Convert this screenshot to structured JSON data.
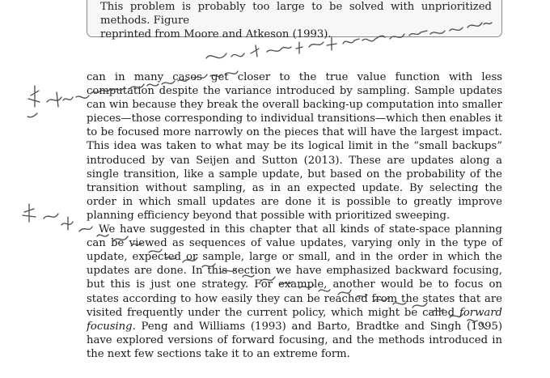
{
  "caption": {
    "line1": "This problem is probably too large to be solved with unprioritized methods. Figure",
    "line2": "reprinted from Moore and Atkeson (1993)."
  },
  "paragraph1": {
    "text": "can in many cases get closer to the true value function with less computation despite the variance introduced by sampling. Sample updates can win because they break the overall backing-up computation into smaller pieces—those corresponding to individual transitions—which then enables it to be focused more narrowly on the pieces that will have the largest impact. This idea was taken to what may be its logical limit in the “small backups” introduced by van Seijen and Sutton (2013). These are updates along a single transition, like a sample update, but based on the probability of the transition without sampling, as in an expected update. By selecting the order in which small updates are done it is possible to greatly improve planning efficiency beyond that possible with prioritized sweeping."
  },
  "paragraph2": {
    "before_italic": "We have suggested in this chapter that all kinds of state-space planning can be viewed as sequences of value updates, varying only in the type of update, expected or sample, large or small, and in the order in which the updates are done. In this section we have emphasized backward focusing, but this is just one strategy. For example, another would be to focus on states according to how easily they can be reached from the states that are visited frequently under the current policy, which might be called",
    "italic": "forward focusing",
    "after_italic": ". Peng and Williams (1993) and Barto, Bradtke and Singh (1995) have explored versions of forward focusing, and the methods introduced in the next few sections take it to an extreme form."
  },
  "handwriting_icon": "handwritten-chinese-scribbles"
}
